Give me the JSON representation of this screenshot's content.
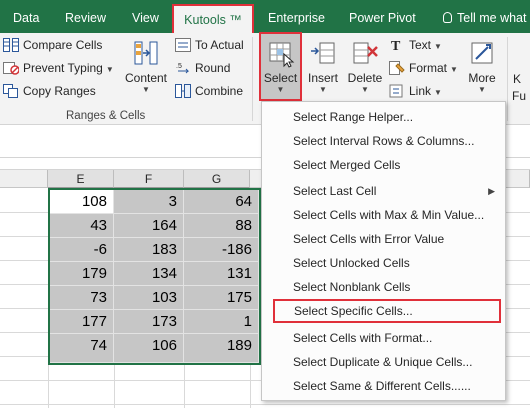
{
  "tabs": {
    "data": "Data",
    "review": "Review",
    "view": "View",
    "kutools": "Kutools ™",
    "enterprise": "Enterprise",
    "power_pivot": "Power Pivot",
    "tell_me": "Tell me what"
  },
  "ribbon": {
    "compare_cells": "Compare Cells",
    "prevent_typing": "Prevent Typing",
    "copy_ranges": "Copy Ranges",
    "content": "Content",
    "to_actual": "To Actual",
    "round": "Round",
    "combine": "Combine",
    "ranges_cells_group": "Ranges & Cells",
    "select": "Select",
    "insert": "Insert",
    "delete": "Delete",
    "text": "Text",
    "format": "Format",
    "link": "Link",
    "more": "More",
    "cut_k": "K",
    "cut_fu": "Fu"
  },
  "grid": {
    "columns": [
      "E",
      "F",
      "G"
    ],
    "rows": [
      [
        "108",
        "3",
        "64"
      ],
      [
        "43",
        "164",
        "88"
      ],
      [
        "-6",
        "183",
        "-186"
      ],
      [
        "179",
        "134",
        "131"
      ],
      [
        "73",
        "103",
        "175"
      ],
      [
        "177",
        "173",
        "1"
      ],
      [
        "74",
        "106",
        "189"
      ]
    ]
  },
  "menu": {
    "items": [
      "Select Range Helper...",
      "Select Interval Rows & Columns...",
      "Select Merged Cells",
      "Select Last Cell",
      "Select Cells with Max & Min Value...",
      "Select Cells with Error Value",
      "Select Unlocked Cells",
      "Select Nonblank Cells",
      "Select Specific Cells...",
      "Select Cells with Format...",
      "Select Duplicate & Unique Cells...",
      "Select Same & Different Cells......"
    ]
  },
  "colors": {
    "excel_green": "#217346",
    "highlight_red": "#e0303a",
    "selection_gray": "#c6c6c6"
  }
}
